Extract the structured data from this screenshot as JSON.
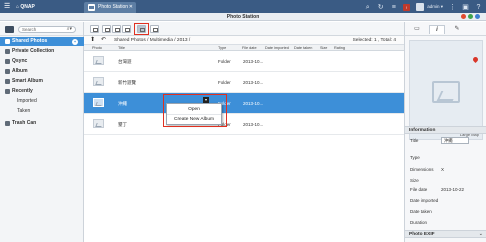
{
  "topbar": {
    "logo": "⌂ QNAP",
    "tab_label": "Photo Station",
    "tab_close": "✕",
    "user_label": "admin ▾"
  },
  "app": {
    "title": "Photo Station",
    "dot_colors": [
      "#e04a2f",
      "#3fa34d",
      "#3d7fd0"
    ]
  },
  "sidebar": {
    "search_placeholder": "Search",
    "items": [
      {
        "label": "Shared Photos",
        "badge": "+",
        "selected": true
      },
      {
        "label": "Private Collection"
      },
      {
        "label": "Qsync"
      },
      {
        "label": "Album"
      },
      {
        "label": "Smart Album"
      },
      {
        "label": "Recently"
      },
      {
        "label": "Imported"
      },
      {
        "label": "Taken"
      },
      {
        "label": "Trash Can"
      }
    ]
  },
  "breadcrumb": {
    "path": "Shared Photos / Multimedia / 2013 /",
    "count": "Selected: 1 , Total: 4"
  },
  "columns": [
    "Photo",
    "Title",
    "Type",
    "File date",
    "Date imported",
    "Date taken",
    "Size",
    "Rating"
  ],
  "rows": [
    {
      "title": "台灣遊",
      "type": "Folder",
      "date": "2013-10..."
    },
    {
      "title": "新竹遊覽",
      "type": "Folder",
      "date": "2013-10..."
    },
    {
      "title": "沖繩",
      "type": "Folder",
      "date": "2013-10...",
      "selected": true
    },
    {
      "title": "墾丁",
      "type": "Folder",
      "date": "2013-10..."
    }
  ],
  "context_menu": {
    "items": [
      "Open",
      "Create New Album"
    ]
  },
  "right_panel": {
    "map_label": "Large Map",
    "info_header": "Information",
    "exif_header": "Photo EXIF",
    "fields": [
      {
        "label": "Title",
        "value": "沖繩",
        "boxed": true
      },
      {
        "label": "Type",
        "value": ""
      },
      {
        "label": "Dimensions",
        "value": "X"
      },
      {
        "label": "Size",
        "value": ""
      },
      {
        "label": "File date",
        "value": "2013-10-22"
      },
      {
        "label": "Date imported",
        "value": ""
      },
      {
        "label": "Date taken",
        "value": ""
      },
      {
        "label": "Duration",
        "value": ""
      }
    ]
  }
}
